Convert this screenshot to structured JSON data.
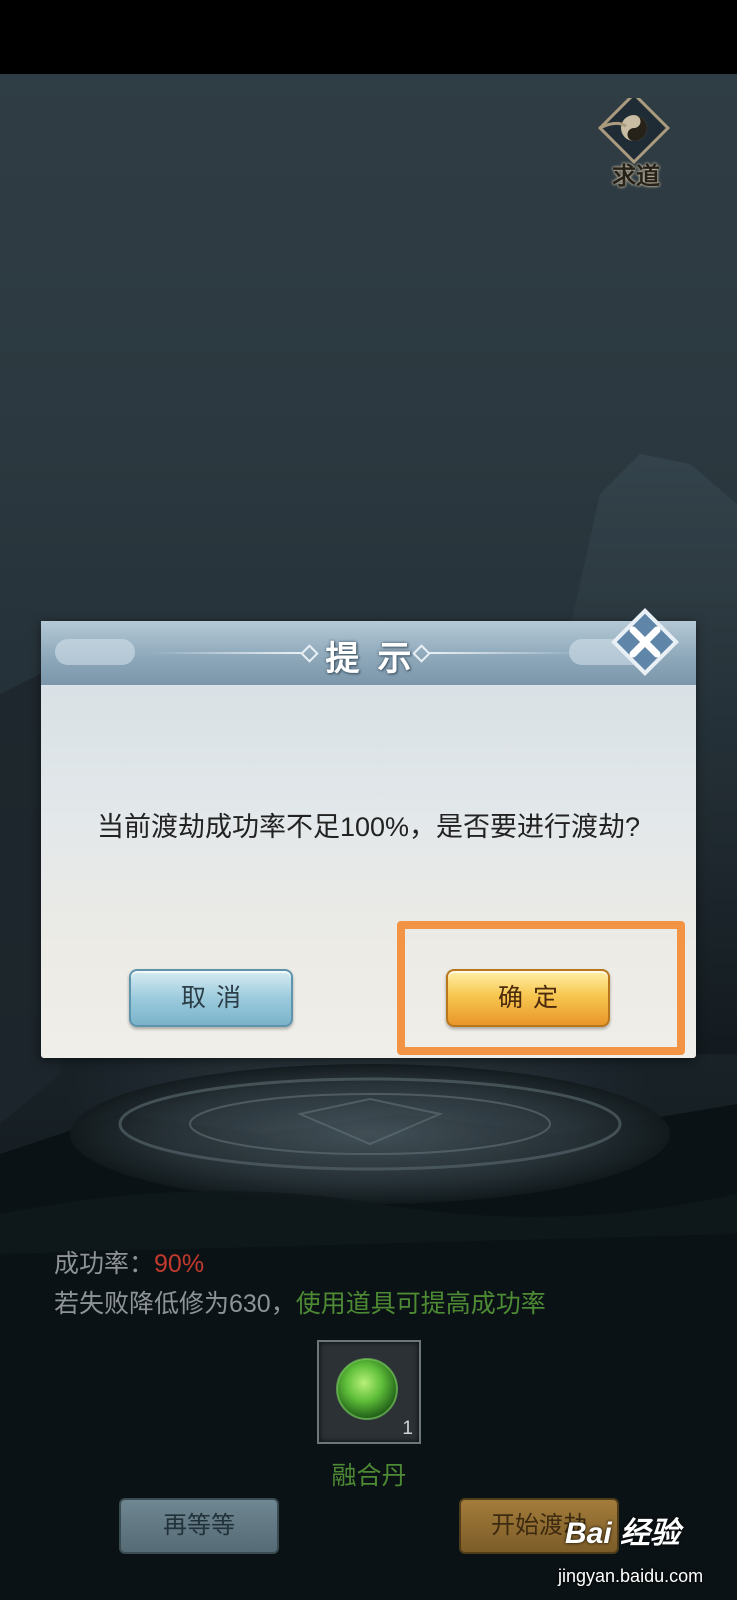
{
  "emblem": {
    "label": "求道"
  },
  "dialog": {
    "title": "提示",
    "message": "当前渡劫成功率不足100%，是否要进行渡劫?",
    "cancel_label": "取消",
    "confirm_label": "确定"
  },
  "info": {
    "success_rate_label": "成功率：",
    "success_rate_value": "90%",
    "fail_text": "若失败降低修为630，",
    "hint_text": "使用道具可提高成功率"
  },
  "item": {
    "name": "融合丹",
    "count": "1"
  },
  "actions": {
    "wait_label": "再等等",
    "start_label": "开始渡劫"
  },
  "watermark": {
    "logo": "Bai 经验",
    "url": "jingyan.baidu.com"
  },
  "colors": {
    "highlight": "#f39444",
    "red": "#c23a2d",
    "green": "#4d8a34"
  }
}
